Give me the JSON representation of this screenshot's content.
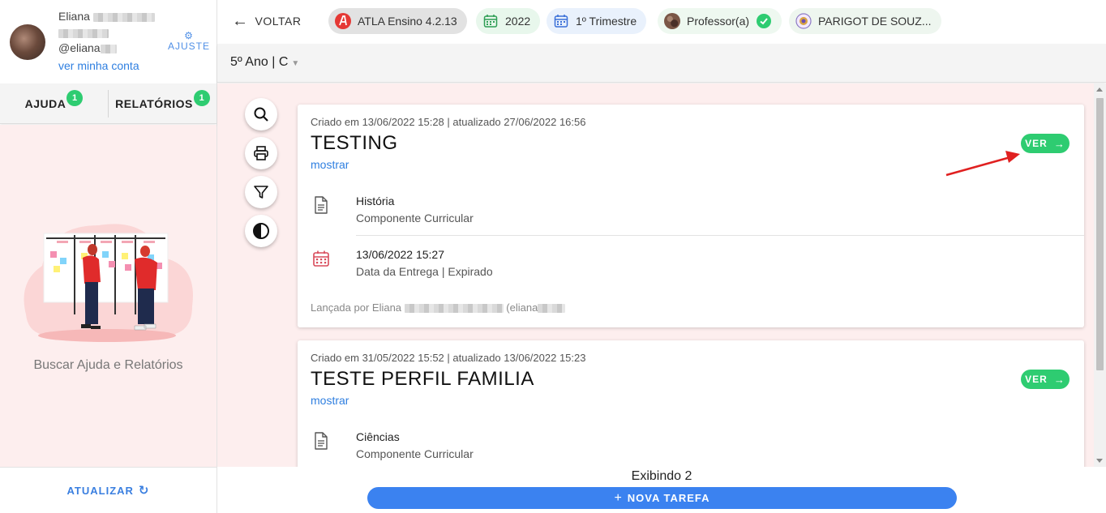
{
  "profile": {
    "name": "Eliana",
    "username": "@eliana",
    "account_link": "ver minha conta",
    "settings_label": "AJUSTE"
  },
  "sidebar_tabs": [
    {
      "label": "AJUDA",
      "badge": "1"
    },
    {
      "label": "RELATÓRIOS",
      "badge": "1"
    }
  ],
  "help": {
    "caption": "Buscar Ajuda e Relatórios"
  },
  "refresh_label": "ATUALIZAR",
  "topbar": {
    "back_label": "VOLTAR",
    "chips": {
      "app": "ATLA Ensino 4.2.13",
      "year": "2022",
      "term": "1º Trimestre",
      "role": "Professor(a)",
      "school": "PARIGOT DE SOUZ..."
    }
  },
  "class_selector": "5º Ano | C",
  "tasks": [
    {
      "meta": "Criado em 13/06/2022 15:28 | atualizado 27/06/2022 16:56",
      "title": "TESTING",
      "show_label": "mostrar",
      "view_label": "VER",
      "subject": "História",
      "subject_label": "Componente Curricular",
      "due": "13/06/2022 15:27",
      "due_label": "Data da Entrega | Expirado",
      "posted_by": "Lançada por Eliana",
      "posted_user": "(eliana"
    },
    {
      "meta": "Criado em 31/05/2022 15:52 | atualizado 13/06/2022 15:23",
      "title": "TESTE PERFIL FAMILIA",
      "show_label": "mostrar",
      "view_label": "VER",
      "subject": "Ciências",
      "subject_label": "Componente Curricular"
    }
  ],
  "footer": {
    "showing": "Exibindo 2",
    "new_task": "NOVA TAREFA"
  },
  "colors": {
    "accent_blue": "#3b82f0",
    "success_green": "#2ecc71",
    "content_bg": "#fdeeee",
    "annotation_red": "#e02020"
  },
  "icons": [
    "search-icon",
    "print-icon",
    "filter-icon",
    "contrast-icon",
    "document-icon",
    "calendar-icon",
    "gear-icon",
    "refresh-icon",
    "arrow-left-icon",
    "arrow-right-icon",
    "plus-icon"
  ]
}
